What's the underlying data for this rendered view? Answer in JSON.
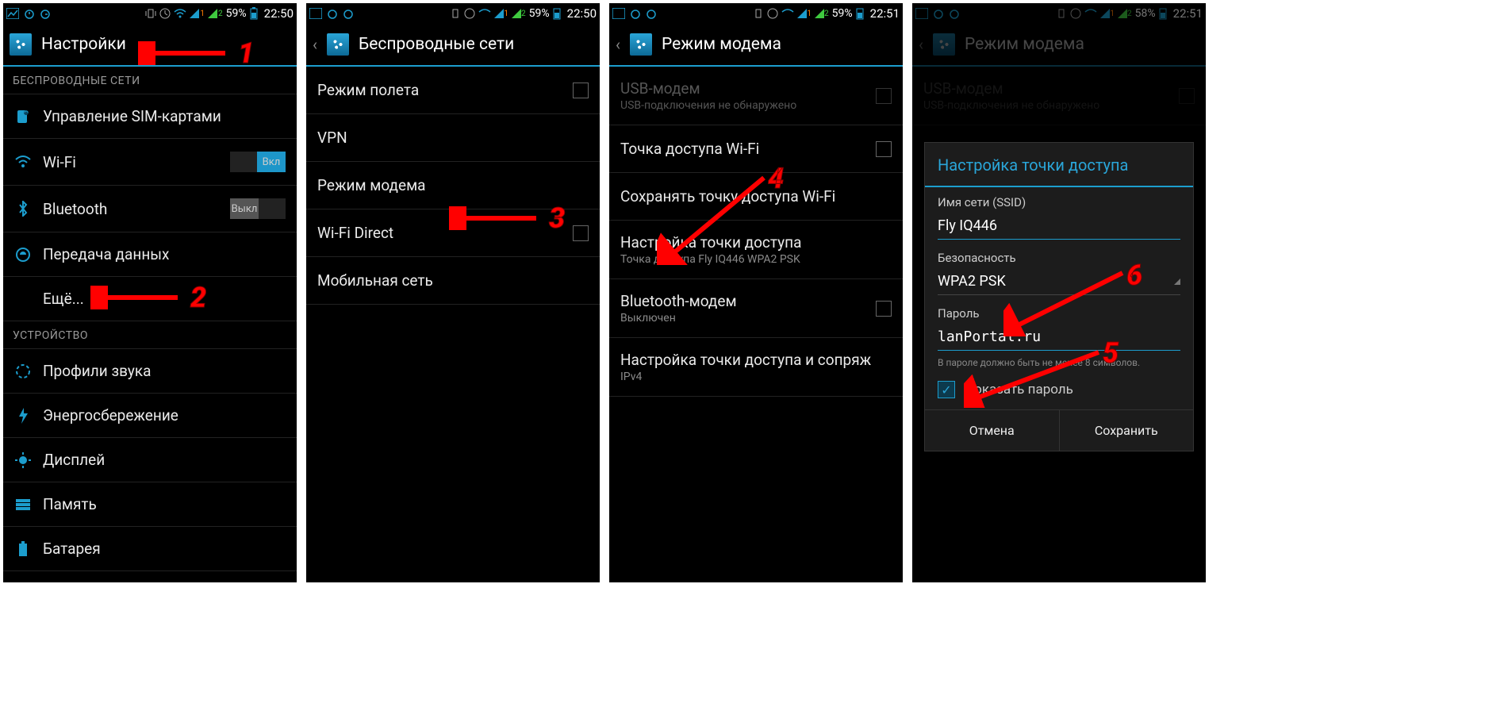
{
  "status": {
    "battery1": "59%",
    "time1": "22:50",
    "battery2": "59%",
    "time2": "22:50",
    "battery3": "59%",
    "time3": "22:51",
    "battery4": "58%",
    "time4": "22:51"
  },
  "p1": {
    "title": "Настройки",
    "sec_wireless": "БЕСПРОВОДНЫЕ СЕТИ",
    "sim": "Управление SIM-картами",
    "wifi": "Wi-Fi",
    "wifi_toggle": "Вкл",
    "bt": "Bluetooth",
    "bt_toggle": "Выкл",
    "data": "Передача данных",
    "more": "Ещё...",
    "sec_device": "УСТРОЙСТВО",
    "audio": "Профили звука",
    "power": "Энергосбережение",
    "display": "Дисплей",
    "memory": "Память",
    "battery": "Батарея"
  },
  "p2": {
    "title": "Беспроводные сети",
    "airplane": "Режим полета",
    "vpn": "VPN",
    "tether": "Режим модема",
    "wifidirect": "Wi-Fi Direct",
    "mobile": "Мобильная сеть"
  },
  "p3": {
    "title": "Режим модема",
    "usb": "USB-модем",
    "usb_sub": "USB-подключения не обнаружено",
    "wifi_ap": "Точка доступа Wi-Fi",
    "keep_ap": "Сохранять точку доступа Wi-Fi",
    "ap_setup": "Настройка точки доступа",
    "ap_setup_sub": "Точка доступа Fly IQ446 WPA2 PSK",
    "bt_modem": "Bluetooth-модем",
    "bt_modem_sub": "Выключен",
    "ipv4": "Настройка точки доступа и сопряж",
    "ipv4_sub": "IPv4"
  },
  "p4": {
    "title": "Режим модема",
    "usb": "USB-модем",
    "usb_sub": "USB-подключения не обнаружено",
    "dlg_title": "Настройка точки доступа",
    "ssid_label": "Имя сети (SSID)",
    "ssid_value": "Fly IQ446",
    "sec_label": "Безопасность",
    "sec_value": "WPA2 PSK",
    "pwd_label": "Пароль",
    "pwd_value": "lanPortal.ru",
    "pwd_hint": "В пароле должно быть не менее 8 символов.",
    "show_pwd": "Показать пароль",
    "cancel": "Отмена",
    "save": "Сохранить"
  },
  "anno": {
    "n1": "1",
    "n2": "2",
    "n3": "3",
    "n4": "4",
    "n5": "5",
    "n6": "6"
  }
}
